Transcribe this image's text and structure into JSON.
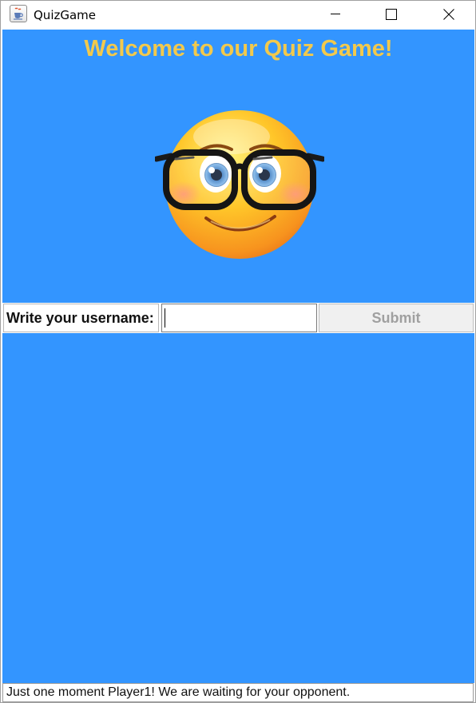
{
  "window": {
    "title": "QuizGame",
    "app_icon": "java-coffee-cup-icon",
    "controls": [
      "minimize-icon",
      "maximize-icon",
      "close-icon"
    ]
  },
  "main": {
    "welcome_text": "Welcome to our Quiz Game!",
    "mascot": "nerd-face-emoji-with-glasses",
    "background_color": "#3395ff",
    "title_color": "#f2c94c"
  },
  "form": {
    "username_label": "Write your username:",
    "username_value": "",
    "submit_label": "Submit",
    "submit_enabled": false
  },
  "status": {
    "message": "Just one moment Player1! We are waiting for your opponent."
  }
}
